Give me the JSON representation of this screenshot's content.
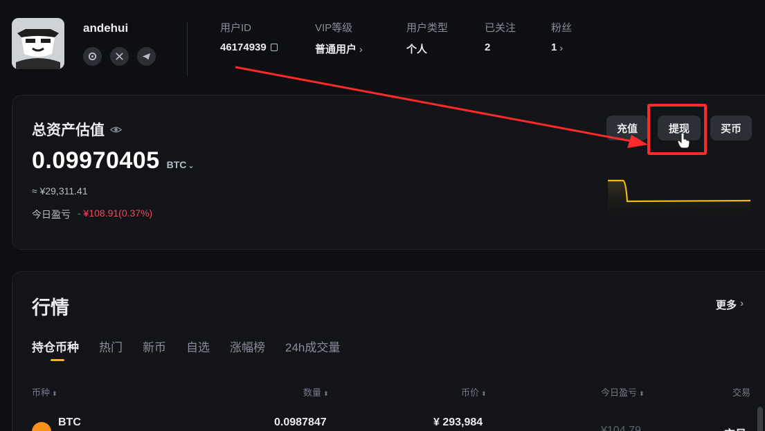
{
  "profile": {
    "username": "andehui",
    "socials": [
      "link-icon",
      "x-icon",
      "telegram-icon"
    ]
  },
  "stats": [
    {
      "label": "用户ID",
      "value": "46174939",
      "icon": "copy-icon"
    },
    {
      "label": "VIP等级",
      "value": "普通用户",
      "chevron": "›"
    },
    {
      "label": "用户类型",
      "value": "个人"
    },
    {
      "label": "已关注",
      "value": "2"
    },
    {
      "label": "粉丝",
      "value": "1",
      "chevron": "›"
    }
  ],
  "asset": {
    "title": "总资产估值",
    "value": "0.09970405",
    "unit": "BTC",
    "approx": "≈ ¥29,311.41",
    "pnl_label": "今日盈亏",
    "pnl_value": "- ¥108.91(0.37%)",
    "buttons": {
      "deposit": "充值",
      "withdraw": "提现",
      "buy": "买币"
    },
    "sparkline_color": "#f0b90b"
  },
  "market": {
    "title": "行情",
    "more": "更多",
    "tabs": [
      "持仓币种",
      "热门",
      "新币",
      "自选",
      "涨幅榜",
      "24h成交量"
    ],
    "columns": [
      "币种",
      "数量",
      "币价",
      "今日盈亏",
      "交易"
    ],
    "rows": [
      {
        "coin": "BTC",
        "amount": "0.0987847",
        "price": "¥ 293,984",
        "pnl": "¥104.79",
        "action": "交易"
      }
    ]
  },
  "colors": {
    "accent": "#f0b90b",
    "negative": "#f6465d",
    "highlight": "#ff2a2a"
  }
}
